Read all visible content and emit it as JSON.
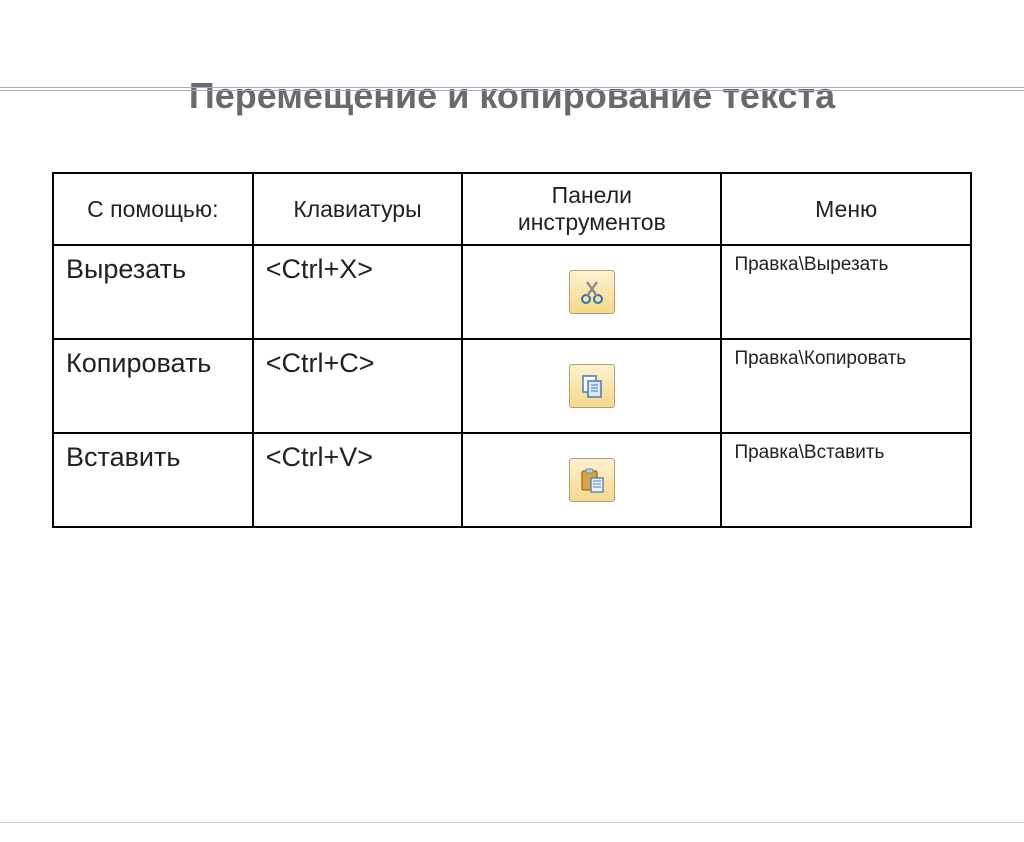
{
  "title": "Перемещение и копирование текста",
  "headers": {
    "col1": "С помощью:",
    "col2": "Клавиатуры",
    "col3": "Панели инструментов",
    "col4": "Меню"
  },
  "rows": [
    {
      "action": "Вырезать",
      "shortcut": "<Ctrl+X>",
      "icon": "cut",
      "menu": "Правка\\Вырезать"
    },
    {
      "action": "Копировать",
      "shortcut": "<Ctrl+C>",
      "icon": "copy",
      "menu": "Правка\\Копировать"
    },
    {
      "action": "Вставить",
      "shortcut": "<Ctrl+V>",
      "icon": "paste",
      "menu": "Правка\\Вставить"
    }
  ]
}
